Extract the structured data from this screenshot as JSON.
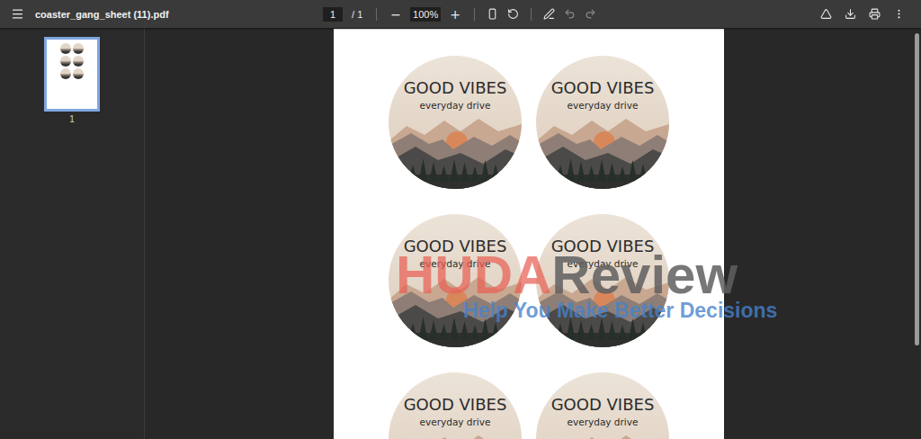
{
  "toolbar": {
    "file_name": "coaster_gang_sheet (11).pdf",
    "page_input": "1",
    "page_total": "/ 1",
    "zoom_out": "−",
    "zoom": "100%",
    "zoom_in": "+"
  },
  "sidebar": {
    "thumbnails": [
      {
        "label": "1",
        "selected": true
      }
    ]
  },
  "document": {
    "coasters": [
      {
        "title": "GOOD VIBES",
        "subtitle": "everyday drive"
      },
      {
        "title": "GOOD VIBES",
        "subtitle": "everyday drive"
      },
      {
        "title": "GOOD VIBES",
        "subtitle": "everyday drive"
      },
      {
        "title": "GOOD VIBES",
        "subtitle": "everyday drive"
      },
      {
        "title": "GOOD VIBES",
        "subtitle": "everyday drive"
      },
      {
        "title": "GOOD VIBES",
        "subtitle": "everyday drive"
      }
    ]
  },
  "scrollbar": {
    "level": 0.76
  },
  "watermark": {
    "brand_a": "HUDA",
    "brand_b": "Review",
    "tagline": "Help You Make Better Decisions"
  }
}
